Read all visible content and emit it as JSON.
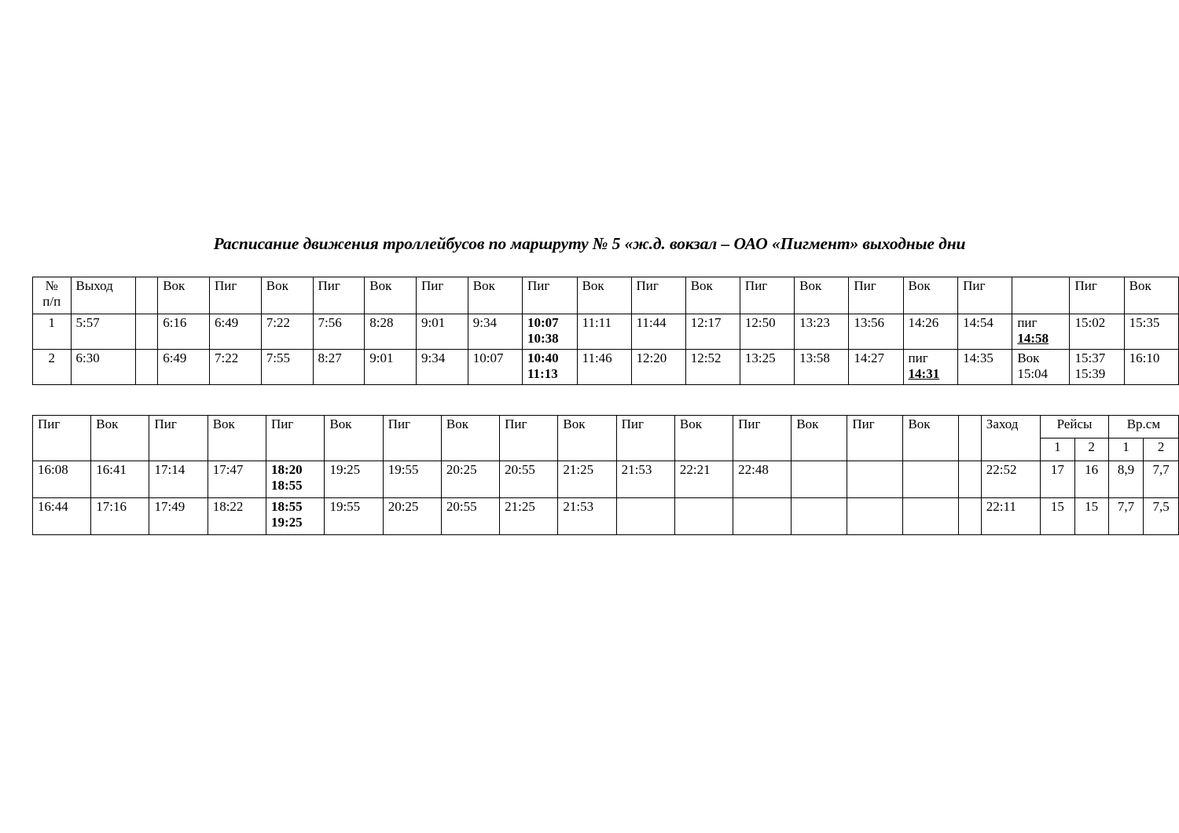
{
  "document": {
    "title": "Расписание движения троллейбусов по маршруту № 5 «ж.д. вокзал – ОАО «Пигмент»  выходные дни"
  },
  "table1": {
    "headers": [
      "№\nп/п",
      "Выход",
      "",
      "Вок",
      "Пиг",
      "Вок",
      "Пиг",
      "Вок",
      "Пиг",
      "Вок",
      "Пиг",
      "Вок",
      "Пиг",
      "Вок",
      "Пиг",
      "Вок",
      "Пиг",
      "Вок",
      "Пиг",
      "",
      "Пиг",
      "Вок"
    ],
    "header_num_line1": "№",
    "header_num_line2": "п/п",
    "header_vyhod": "Выход",
    "header_blank": "",
    "header_vok": "Вок",
    "header_pig": "Пиг",
    "rows": [
      {
        "num": "1",
        "vyhod": "5:57",
        "gap": "",
        "times": [
          {
            "l1": "6:16",
            "l2": "",
            "style": ""
          },
          {
            "l1": "6:49",
            "l2": "",
            "style": ""
          },
          {
            "l1": "7:22",
            "l2": "",
            "style": ""
          },
          {
            "l1": "7:56",
            "l2": "",
            "style": ""
          },
          {
            "l1": "8:28",
            "l2": "",
            "style": ""
          },
          {
            "l1": "9:01",
            "l2": "",
            "style": ""
          },
          {
            "l1": "9:34",
            "l2": "",
            "style": ""
          },
          {
            "l1": "10:07",
            "l2": "10:38",
            "style": "bold-bold"
          },
          {
            "l1": "11:11",
            "l2": "",
            "style": ""
          },
          {
            "l1": "11:44",
            "l2": "",
            "style": ""
          },
          {
            "l1": "12:17",
            "l2": "",
            "style": ""
          },
          {
            "l1": "12:50",
            "l2": "",
            "style": ""
          },
          {
            "l1": "13:23",
            "l2": "",
            "style": ""
          },
          {
            "l1": "13:56",
            "l2": "",
            "style": ""
          },
          {
            "l1": "14:26",
            "l2": "",
            "style": ""
          },
          {
            "l1": "14:54",
            "l2": "",
            "style": ""
          },
          {
            "l1": "пиг",
            "l2": "14:58",
            "style": "plain-underline"
          },
          {
            "l1": "15:02",
            "l2": "",
            "style": ""
          },
          {
            "l1": "15:35",
            "l2": "",
            "style": ""
          }
        ]
      },
      {
        "num": "2",
        "vyhod": "6:30",
        "gap": "",
        "times": [
          {
            "l1": "6:49",
            "l2": "",
            "style": ""
          },
          {
            "l1": "7:22",
            "l2": "",
            "style": ""
          },
          {
            "l1": "7:55",
            "l2": "",
            "style": ""
          },
          {
            "l1": "8:27",
            "l2": "",
            "style": ""
          },
          {
            "l1": "9:01",
            "l2": "",
            "style": ""
          },
          {
            "l1": "9:34",
            "l2": "",
            "style": ""
          },
          {
            "l1": "10:07",
            "l2": "",
            "style": ""
          },
          {
            "l1": "10:40",
            "l2": "11:13",
            "style": "bold-bold"
          },
          {
            "l1": "11:46",
            "l2": "",
            "style": ""
          },
          {
            "l1": "12:20",
            "l2": "",
            "style": ""
          },
          {
            "l1": "12:52",
            "l2": "",
            "style": ""
          },
          {
            "l1": "13:25",
            "l2": "",
            "style": ""
          },
          {
            "l1": "13:58",
            "l2": "",
            "style": ""
          },
          {
            "l1": "14:27",
            "l2": "",
            "style": ""
          },
          {
            "l1": "пиг",
            "l2": "14:31",
            "style": "plain-underline"
          },
          {
            "l1": "14:35",
            "l2": "",
            "style": ""
          },
          {
            "l1": "Вок",
            "l2": "15:04",
            "style": "plain-plain"
          },
          {
            "l1": "15:37",
            "l2": "15:39",
            "style": "plain-plain"
          },
          {
            "l1": "16:10",
            "l2": "",
            "style": ""
          }
        ]
      }
    ]
  },
  "table2": {
    "header_pig": "Пиг",
    "header_vok": "Вок",
    "header_blank": "",
    "header_zahod": "Заход",
    "header_reysy": "Рейсы",
    "header_vrsm": "Вр.см",
    "sub_1": "1",
    "sub_2": "2",
    "headers": [
      "Пиг",
      "Вок",
      "Пиг",
      "Вок",
      "Пиг",
      "Вок",
      "Пиг",
      "Вок",
      "Пиг",
      "Вок",
      "Пиг",
      "Вок",
      "Пиг",
      "Вок",
      "Пиг",
      "Вок",
      "",
      "Заход",
      "Рейсы",
      "Вр.см"
    ],
    "rows": [
      {
        "times": [
          {
            "l1": "16:08",
            "l2": "",
            "style": ""
          },
          {
            "l1": "16:41",
            "l2": "",
            "style": ""
          },
          {
            "l1": "17:14",
            "l2": "",
            "style": ""
          },
          {
            "l1": "17:47",
            "l2": "",
            "style": ""
          },
          {
            "l1": "18:20",
            "l2": "18:55",
            "style": "bold-bold"
          },
          {
            "l1": "19:25",
            "l2": "",
            "style": ""
          },
          {
            "l1": "19:55",
            "l2": "",
            "style": ""
          },
          {
            "l1": "20:25",
            "l2": "",
            "style": ""
          },
          {
            "l1": "20:55",
            "l2": "",
            "style": ""
          },
          {
            "l1": "21:25",
            "l2": "",
            "style": ""
          },
          {
            "l1": "21:53",
            "l2": "",
            "style": ""
          },
          {
            "l1": "22:21",
            "l2": "",
            "style": ""
          },
          {
            "l1": "22:48",
            "l2": "",
            "style": ""
          },
          {
            "l1": "",
            "l2": "",
            "style": ""
          },
          {
            "l1": "",
            "l2": "",
            "style": ""
          },
          {
            "l1": "",
            "l2": "",
            "style": ""
          }
        ],
        "narrow": "",
        "zahod": "22:52",
        "reysy_1": "17",
        "reysy_2": "16",
        "vrsm_1": "8,9",
        "vrsm_2": "7,7"
      },
      {
        "times": [
          {
            "l1": "16:44",
            "l2": "",
            "style": ""
          },
          {
            "l1": "17:16",
            "l2": "",
            "style": ""
          },
          {
            "l1": "17:49",
            "l2": "",
            "style": ""
          },
          {
            "l1": "18:22",
            "l2": "",
            "style": ""
          },
          {
            "l1": "18:55",
            "l2": "19:25",
            "style": "bold-bold"
          },
          {
            "l1": "19:55",
            "l2": "",
            "style": ""
          },
          {
            "l1": "20:25",
            "l2": "",
            "style": ""
          },
          {
            "l1": "20:55",
            "l2": "",
            "style": ""
          },
          {
            "l1": "21:25",
            "l2": "",
            "style": ""
          },
          {
            "l1": "21:53",
            "l2": "",
            "style": ""
          },
          {
            "l1": "",
            "l2": "",
            "style": ""
          },
          {
            "l1": "",
            "l2": "",
            "style": ""
          },
          {
            "l1": "",
            "l2": "",
            "style": ""
          },
          {
            "l1": "",
            "l2": "",
            "style": ""
          },
          {
            "l1": "",
            "l2": "",
            "style": ""
          },
          {
            "l1": "",
            "l2": "",
            "style": ""
          }
        ],
        "narrow": "",
        "zahod": "22:11",
        "reysy_1": "15",
        "reysy_2": "15",
        "vrsm_1": "7,7",
        "vrsm_2": "7,5"
      }
    ]
  }
}
